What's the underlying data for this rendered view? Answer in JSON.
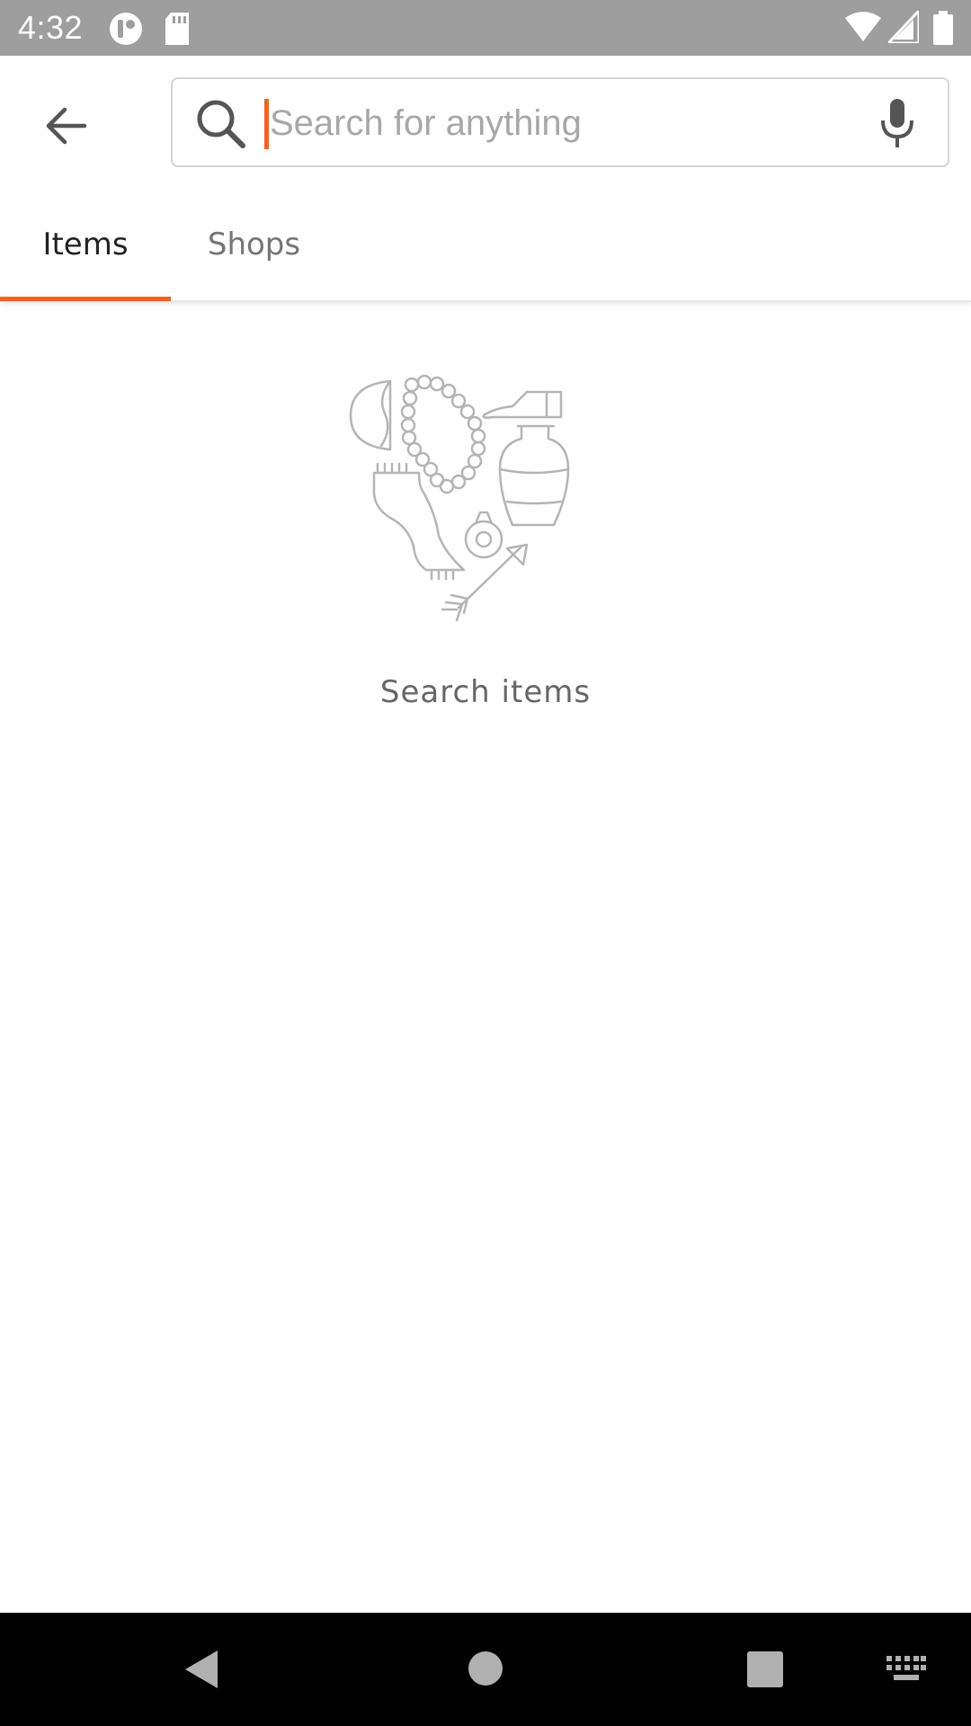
{
  "status_bar": {
    "time": "4:32",
    "icons": [
      "app-notification-icon",
      "sd-card-icon",
      "wifi-icon",
      "signal-icon",
      "battery-icon"
    ]
  },
  "header": {
    "back_icon": "arrow-left-icon",
    "search": {
      "placeholder": "Search for anything",
      "value": "",
      "icon": "search-icon",
      "voice_icon": "microphone-icon"
    }
  },
  "tabs": [
    {
      "label": "Items",
      "selected": true
    },
    {
      "label": "Shops",
      "selected": false
    }
  ],
  "empty_state": {
    "illustration": "craft-items-heart-illustration",
    "label": "Search items"
  },
  "nav_bar": {
    "icons": [
      "back-triangle-icon",
      "home-circle-icon",
      "recents-square-icon",
      "keyboard-icon"
    ]
  },
  "colors": {
    "accent": "#f1641e",
    "status_bar": "#9e9e9e",
    "text_primary": "#222222",
    "text_secondary": "#757575"
  }
}
